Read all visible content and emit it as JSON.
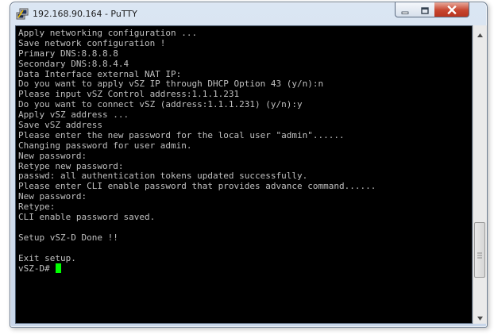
{
  "window": {
    "title": "192.168.90.164 - PuTTY",
    "icons": {
      "app": "putty-terminal-icon",
      "minimize": "minimize-icon",
      "maximize": "maximize-icon",
      "close": "close-icon"
    },
    "colors": {
      "terminal_background": "#000000",
      "terminal_text": "#c0c0c0",
      "cursor": "#00ff00",
      "close_button": "#c7462f"
    }
  },
  "terminal": {
    "lines": [
      "Apply networking configuration ...",
      "Save network configuration !",
      "Primary DNS:8.8.8.8",
      "Secondary DNS:8.8.4.4",
      "Data Interface external NAT IP:",
      "Do you want to apply vSZ IP through DHCP Option 43 (y/n):n",
      "Please input vSZ Control address:1.1.1.231",
      "Do you want to connect vSZ (address:1.1.1.231) (y/n):y",
      "Apply vSZ address ...",
      "Save vSZ address",
      "Please enter the new password for the local user \"admin\"......",
      "Changing password for user admin.",
      "New password:",
      "Retype new password:",
      "passwd: all authentication tokens updated successfully.",
      "Please enter CLI enable password that provides advance command......",
      "New password:",
      "Retype:",
      "CLI enable password saved.",
      "",
      "Setup vSZ-D Done !!",
      "",
      "Exit setup."
    ],
    "prompt": "vSZ-D# "
  },
  "scrollbar": {
    "position_fraction": 0.85
  }
}
